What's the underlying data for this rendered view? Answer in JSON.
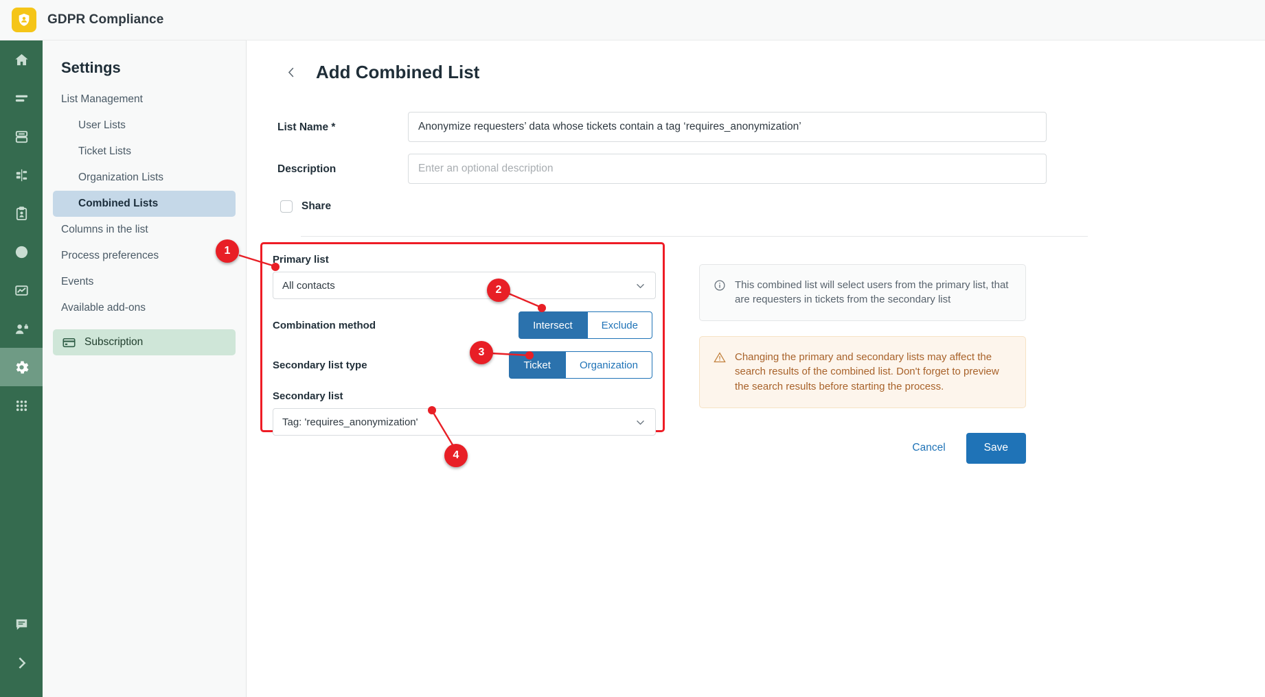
{
  "app": {
    "brand_title": "GDPR Compliance",
    "logo_icon": "shield-user-icon",
    "accent_red": "#e81f26",
    "accent_blue": "#1f73b7",
    "rail_green": "#356b4f",
    "brand_yellow": "#f5c518"
  },
  "rail": {
    "items": [
      {
        "icon": "home-icon",
        "name": "home"
      },
      {
        "icon": "list-icon",
        "name": "lists"
      },
      {
        "icon": "database-icon",
        "name": "database"
      },
      {
        "icon": "flowchart-icon",
        "name": "workflow"
      },
      {
        "icon": "clipboard-user-icon",
        "name": "requests"
      },
      {
        "icon": "clock-icon",
        "name": "history"
      },
      {
        "icon": "chart-line-icon",
        "name": "analytics"
      },
      {
        "icon": "user-lock-icon",
        "name": "privacy"
      },
      {
        "icon": "gear-icon",
        "name": "settings",
        "active": true
      },
      {
        "icon": "grid-apps-icon",
        "name": "apps"
      }
    ],
    "bottom_items": [
      {
        "icon": "comment-icon",
        "name": "feedback"
      },
      {
        "icon": "chevron-right-icon",
        "name": "expand"
      }
    ]
  },
  "settings_nav": {
    "title": "Settings",
    "items": [
      {
        "label": "List Management",
        "level": 1,
        "state": "normal"
      },
      {
        "label": "User Lists",
        "level": 2,
        "state": "normal"
      },
      {
        "label": "Ticket Lists",
        "level": 2,
        "state": "normal"
      },
      {
        "label": "Organization Lists",
        "level": 2,
        "state": "normal"
      },
      {
        "label": "Combined Lists",
        "level": 2,
        "state": "active-blue"
      },
      {
        "label": "Columns in the list",
        "level": 1,
        "state": "normal"
      },
      {
        "label": "Process preferences",
        "level": 1,
        "state": "normal"
      },
      {
        "label": "Events",
        "level": 1,
        "state": "normal"
      },
      {
        "label": "Available add-ons",
        "level": 1,
        "state": "normal"
      },
      {
        "label": "Subscription",
        "level": 1,
        "state": "active-green",
        "icon": "credit-card-icon"
      }
    ]
  },
  "page": {
    "back_icon": "chevron-left-icon",
    "title": "Add Combined List"
  },
  "form": {
    "list_name_label": "List Name *",
    "list_name_value": "Anonymize requesters’ data whose tickets contain a tag ‘requires_anonymization’",
    "description_label": "Description",
    "description_value": "",
    "description_placeholder": "Enter an optional description",
    "share_label": "Share",
    "share_checked": false
  },
  "combination_panel": {
    "primary_list_label": "Primary list",
    "primary_list_value": "All contacts",
    "primary_list_chevron": "chevron-down-icon",
    "combination_method_label": "Combination method",
    "combination_method_options": [
      "Intersect",
      "Exclude"
    ],
    "combination_method_selected": "Intersect",
    "secondary_list_type_label": "Secondary list type",
    "secondary_list_type_options": [
      "Ticket",
      "Organization"
    ],
    "secondary_list_type_selected": "Ticket",
    "secondary_list_label": "Secondary list",
    "secondary_list_value": "Tag: 'requires_anonymization'",
    "secondary_list_chevron": "chevron-down-icon"
  },
  "info_box": {
    "icon": "info-circle-icon",
    "text": "This combined list will select users from the primary list, that are requesters in tickets from the secondary list"
  },
  "warning_box": {
    "icon": "warning-triangle-icon",
    "text": "Changing the primary and secondary lists may affect the search results of the combined list. Don't forget to preview the search results before starting the process."
  },
  "actions": {
    "cancel_label": "Cancel",
    "save_label": "Save"
  },
  "callouts": [
    {
      "number": "1"
    },
    {
      "number": "2"
    },
    {
      "number": "3"
    },
    {
      "number": "4"
    }
  ]
}
